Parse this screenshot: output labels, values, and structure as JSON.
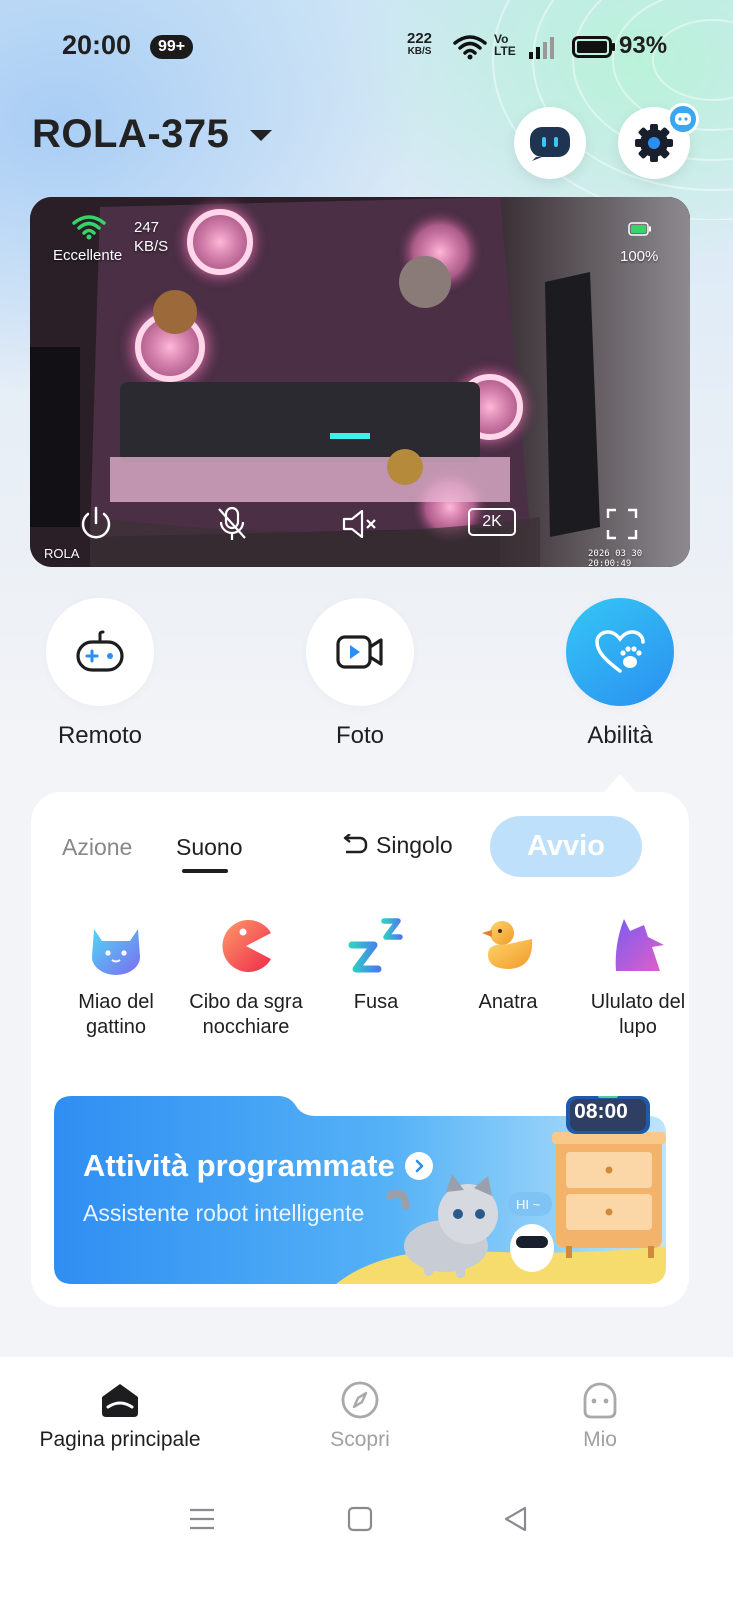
{
  "status_bar": {
    "time": "20:00",
    "notification_count": "99+",
    "net_speed_value": "222",
    "net_speed_unit": "KB/S",
    "volte_top": "Vo",
    "volte_bottom": "LTE",
    "battery_percent": "93%"
  },
  "header": {
    "device_name": "ROLA-375",
    "robot_icon": "robot-face-icon",
    "settings_icon": "gear-icon"
  },
  "video": {
    "connection_quality": "Eccellente",
    "bitrate_value": "247",
    "bitrate_unit": "KB/S",
    "device_battery": "100%",
    "resolution": "2K",
    "brand": "ROLA",
    "timestamp": "2026 03 30 20:00:49",
    "controls": [
      "power-icon",
      "mic-off-icon",
      "speaker-mute-icon",
      "2K",
      "fullscreen-icon"
    ]
  },
  "quick_actions": [
    {
      "label": "Remoto",
      "icon": "gamepad-icon",
      "active": false
    },
    {
      "label": "Foto",
      "icon": "video-camera-icon",
      "active": false
    },
    {
      "label": "Abilità",
      "icon": "heart-paw-icon",
      "active": true
    }
  ],
  "panel": {
    "tabs": [
      "Azione",
      "Suono"
    ],
    "active_tab": "Suono",
    "mode_label": "Singolo",
    "start_label": "Avvio",
    "sounds": [
      {
        "line1": "Miao del",
        "line2": "gattino",
        "icon": "cat-face-icon"
      },
      {
        "line1": "Cibo da sgra",
        "line2": "nocchiare",
        "icon": "chomp-icon"
      },
      {
        "line1": "Fusa",
        "line2": "",
        "icon": "sleep-zzz-icon"
      },
      {
        "line1": "Anatra",
        "line2": "",
        "icon": "duck-icon"
      },
      {
        "line1": "Ululato del",
        "line2": "lupo",
        "icon": "wolf-icon"
      }
    ]
  },
  "banner": {
    "title": "Attività programmate",
    "subtitle": "Assistente robot intelligente",
    "clock": "08:00",
    "speech": "HI ~"
  },
  "bottom_nav": [
    {
      "label": "Pagina principale",
      "icon": "home-icon",
      "active": true
    },
    {
      "label": "Scopri",
      "icon": "compass-icon",
      "active": false
    },
    {
      "label": "Mio",
      "icon": "robot-profile-icon",
      "active": false
    }
  ],
  "colors": {
    "accent_blue": "#2a8ff0",
    "start_button": "#bfe0fb",
    "text_dark": "#1f1f1f",
    "text_muted": "#888888"
  }
}
